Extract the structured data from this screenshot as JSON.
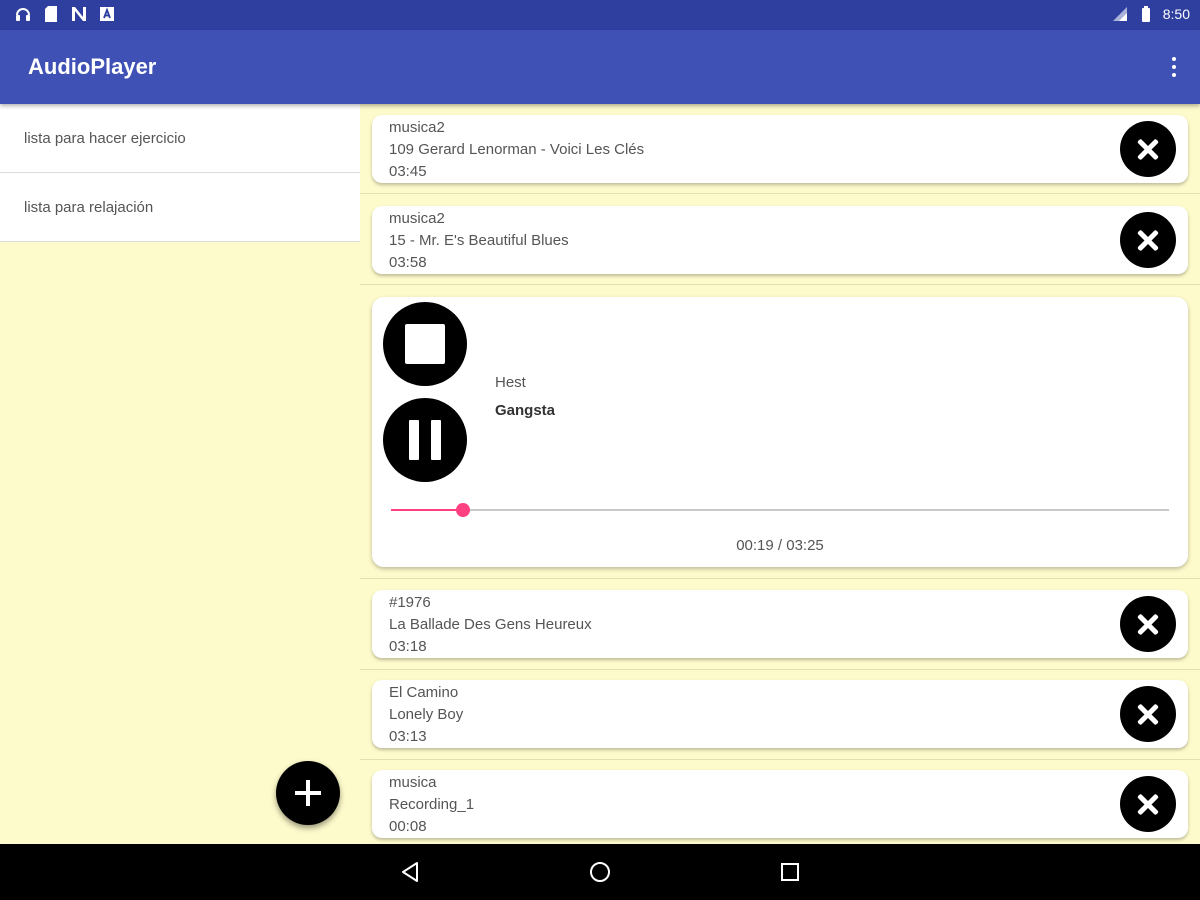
{
  "status_bar": {
    "time": "8:50",
    "icons": [
      "headset-icon",
      "sd-card-icon",
      "n-icon",
      "a-icon",
      "signal-icon",
      "battery-icon"
    ]
  },
  "app_bar": {
    "title": "AudioPlayer",
    "overflow_icon": "more-vert-icon"
  },
  "playlists": [
    {
      "label": "lista para hacer ejercicio"
    },
    {
      "label": "lista para relajación"
    }
  ],
  "tracks_top": [
    {
      "album": "musica2",
      "title": "109 Gerard Lenorman - Voici Les Clés",
      "duration": "03:45"
    },
    {
      "album": "musica2",
      "title": "15 - Mr. E's Beautiful Blues",
      "duration": "03:58"
    }
  ],
  "now_playing": {
    "artist": "Hest",
    "title": "Gangsta",
    "time": "00:19 / 03:25",
    "progress_fraction": 0.0927
  },
  "tracks_bottom": [
    {
      "album": "#1976",
      "title": "La Ballade Des Gens Heureux",
      "duration": "03:18"
    },
    {
      "album": "El Camino",
      "title": "Lonely Boy",
      "duration": "03:13"
    },
    {
      "album": "musica",
      "title": "Recording_1",
      "duration": "00:08"
    }
  ],
  "colors": {
    "app_bar": "#3f51b5",
    "status_bar": "#2e3fa0",
    "background": "#fdfacb",
    "accent": "#ff4081"
  }
}
